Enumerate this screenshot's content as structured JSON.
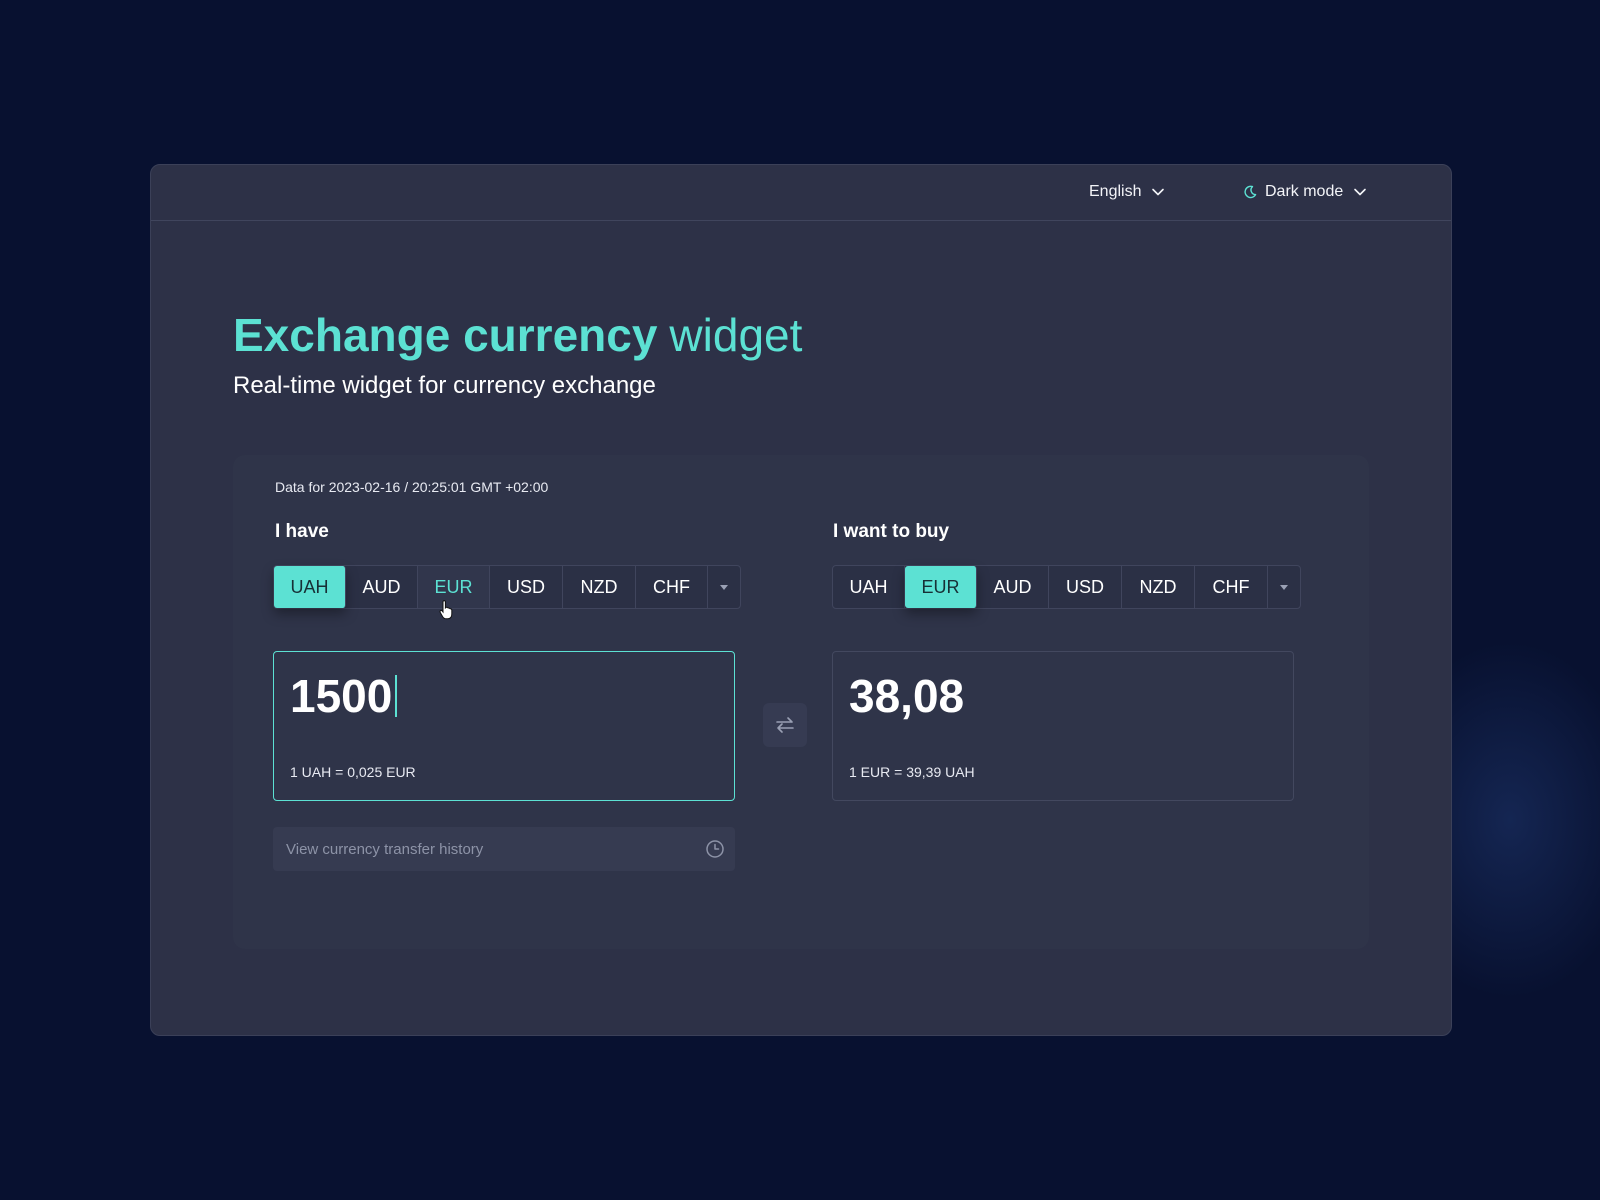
{
  "topbar": {
    "language_label": "English",
    "theme_label": "Dark mode"
  },
  "header": {
    "title_bold": "Exchange currency",
    "title_light": "widget",
    "subtitle": "Real-time widget for currency exchange"
  },
  "widget": {
    "datestamp": "Data for 2023-02-16 / 20:25:01 GMT +02:00",
    "have": {
      "label": "I have",
      "currencies": [
        "UAH",
        "AUD",
        "EUR",
        "USD",
        "NZD",
        "CHF"
      ],
      "selected": "UAH",
      "hovered": "EUR",
      "amount": "1500",
      "rate": "1 UAH = 0,025 EUR"
    },
    "buy": {
      "label": "I want to buy",
      "currencies": [
        "UAH",
        "EUR",
        "AUD",
        "USD",
        "NZD",
        "CHF"
      ],
      "selected": "EUR",
      "amount": "38,08",
      "rate": "1 EUR = 39,39 UAH"
    },
    "history_placeholder": "View currency transfer history"
  },
  "colors": {
    "background": "#081130",
    "panel": "#2d3147",
    "accent": "#5ce1d3"
  },
  "icons": {
    "language_chevron": "chevron-down-icon",
    "theme": "moon-icon",
    "theme_chevron": "chevron-down-icon",
    "more": "caret-down-icon",
    "swap": "swap-arrows-icon",
    "history": "clock-icon"
  }
}
